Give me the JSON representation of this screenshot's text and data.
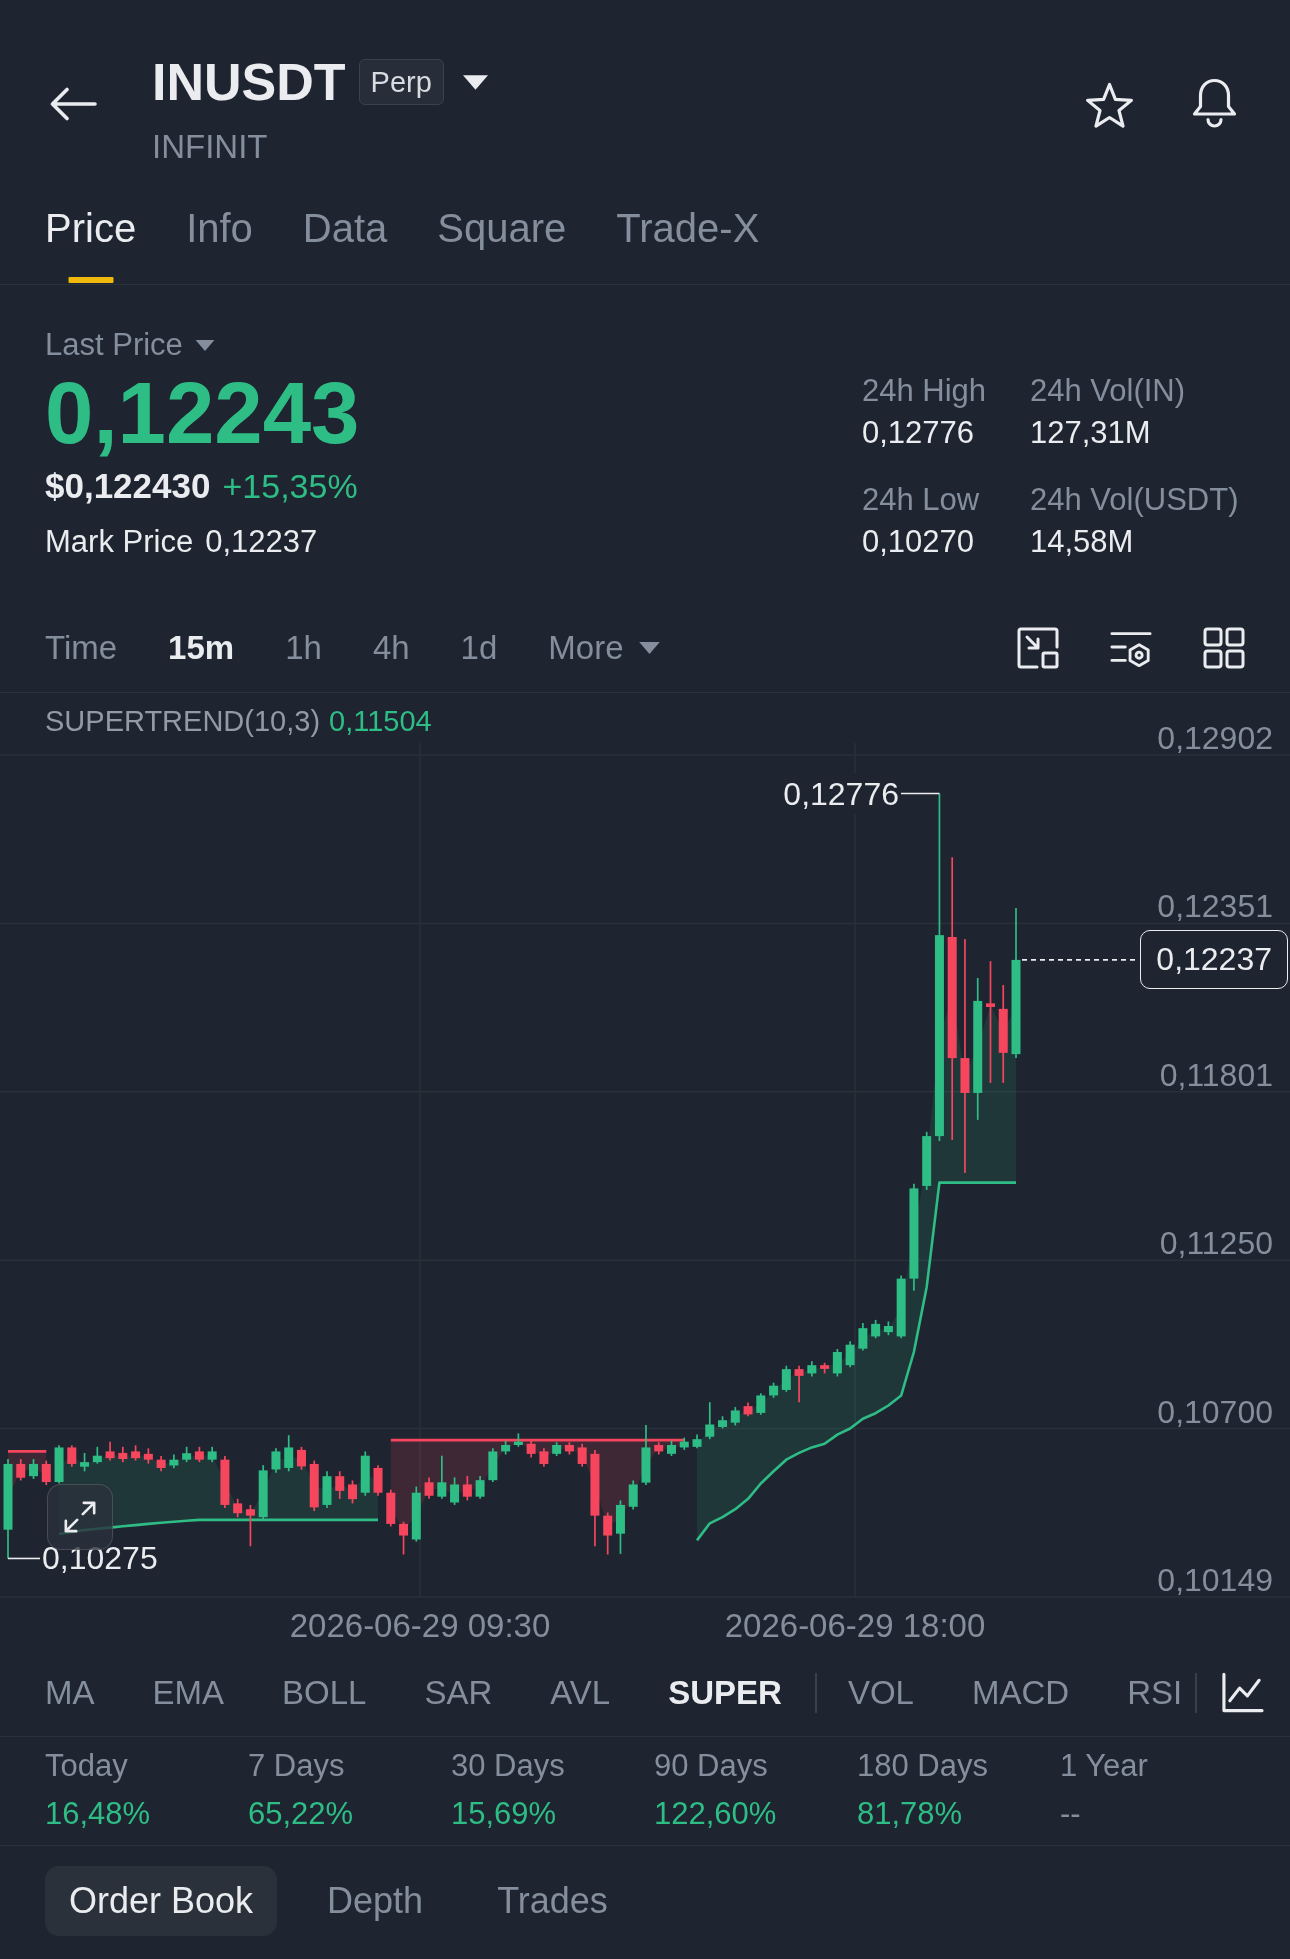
{
  "header": {
    "symbol": "INUSDT",
    "badge": "Perp",
    "subtitle": "INFINIT"
  },
  "tabs": [
    {
      "label": "Price",
      "selected": true
    },
    {
      "label": "Info",
      "selected": false
    },
    {
      "label": "Data",
      "selected": false
    },
    {
      "label": "Square",
      "selected": false
    },
    {
      "label": "Trade-X",
      "selected": false
    }
  ],
  "price": {
    "label": "Last Price",
    "last": "0,12243",
    "rising": true,
    "usd": "$0,122430",
    "change": "+15,35%",
    "mark_label": "Mark Price",
    "mark": "0,12237"
  },
  "stats": [
    {
      "label": "24h High",
      "value": "0,12776"
    },
    {
      "label": "24h Vol(IN)",
      "value": "127,31M"
    },
    {
      "label": "24h Low",
      "value": "0,10270"
    },
    {
      "label": "24h Vol(USDT)",
      "value": "14,58M"
    }
  ],
  "intervals": [
    {
      "label": "Time",
      "kind": "option",
      "selected": false
    },
    {
      "label": "15m",
      "kind": "option",
      "selected": true
    },
    {
      "label": "1h",
      "kind": "option",
      "selected": false
    },
    {
      "label": "4h",
      "kind": "option",
      "selected": false
    },
    {
      "label": "1d",
      "kind": "option",
      "selected": false
    },
    {
      "label": "More",
      "kind": "dropdown",
      "selected": false
    }
  ],
  "chart": {
    "indicator": "SUPERTREND(10,3)",
    "indicator_value": "0,11504",
    "price_scale": [
      "0,12902",
      "0,12351",
      "0,11801",
      "0,11250",
      "0,10700",
      "0,10149"
    ],
    "time_scale": [
      "2026-06-29 09:30",
      "2026-06-29 18:00"
    ],
    "high_marker": "0,12776",
    "low_marker": "0,10275",
    "last_price_tag": "0,12237"
  },
  "main_indicators": [
    {
      "label": "MA",
      "selected": false
    },
    {
      "label": "EMA",
      "selected": false
    },
    {
      "label": "BOLL",
      "selected": false
    },
    {
      "label": "SAR",
      "selected": false
    },
    {
      "label": "AVL",
      "selected": false
    },
    {
      "label": "SUPER",
      "selected": true
    }
  ],
  "sub_indicators": [
    {
      "label": "VOL",
      "selected": false
    },
    {
      "label": "MACD",
      "selected": false
    },
    {
      "label": "RSI",
      "selected": false
    }
  ],
  "performance": [
    {
      "label": "Today",
      "value": "16,48%",
      "kind": "gain"
    },
    {
      "label": "7 Days",
      "value": "65,22%",
      "kind": "gain"
    },
    {
      "label": "30 Days",
      "value": "15,69%",
      "kind": "gain"
    },
    {
      "label": "90 Days",
      "value": "122,60%",
      "kind": "gain"
    },
    {
      "label": "180 Days",
      "value": "81,78%",
      "kind": "gain"
    },
    {
      "label": "1 Year",
      "value": "--",
      "kind": "empty"
    }
  ],
  "book_tabs": [
    {
      "label": "Order Book",
      "selected": true
    },
    {
      "label": "Depth",
      "selected": false
    },
    {
      "label": "Trades",
      "selected": false
    }
  ]
}
